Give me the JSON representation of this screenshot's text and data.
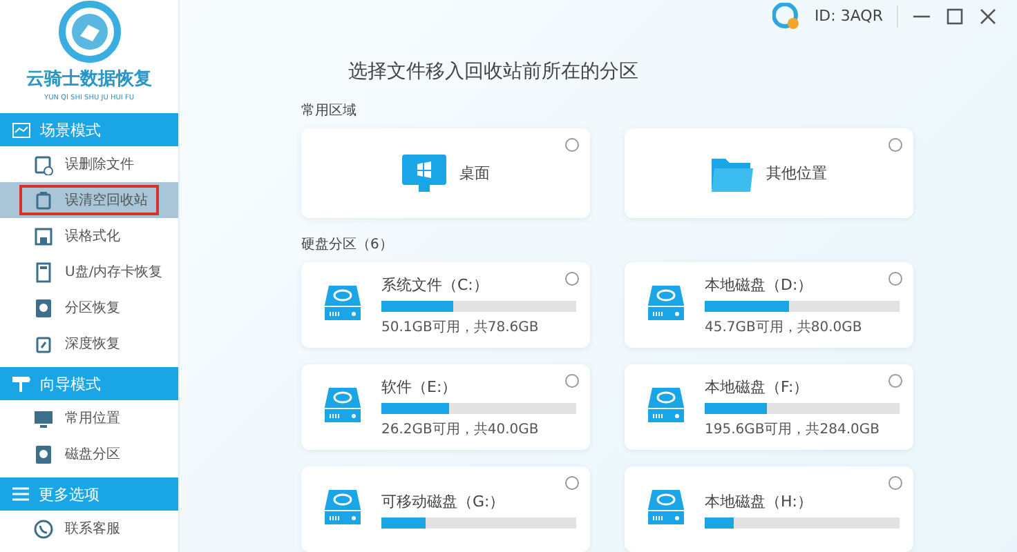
{
  "app": {
    "name": "云骑士数据恢复",
    "subtitle": "YUN QI SHI SHU JU HUI FU"
  },
  "account": {
    "id": "ID: 3AQR"
  },
  "sidebar": [
    {
      "title": "场景模式",
      "kind": "scene",
      "items": [
        {
          "label": "误删除文件",
          "kind": "file",
          "selected": false
        },
        {
          "label": "误清空回收站",
          "kind": "bin",
          "selected": true
        },
        {
          "label": "误格式化",
          "kind": "floppy",
          "selected": false
        },
        {
          "label": "U盘/内存卡恢复",
          "kind": "card",
          "selected": false
        },
        {
          "label": "分区恢复",
          "kind": "disk",
          "selected": false
        },
        {
          "label": "深度恢复",
          "kind": "deep",
          "selected": false
        }
      ]
    },
    {
      "title": "向导模式",
      "kind": "guide",
      "items": [
        {
          "label": "常用位置",
          "kind": "monitor",
          "selected": false
        },
        {
          "label": "磁盘分区",
          "kind": "disk",
          "selected": false
        }
      ]
    },
    {
      "title": "更多选项",
      "kind": "more",
      "items": [
        {
          "label": "联系客服",
          "kind": "phone",
          "selected": false
        }
      ]
    }
  ],
  "heading": "选择文件移入回收站前所在的分区",
  "common": {
    "title": "常用区域",
    "items": [
      {
        "label": "桌面",
        "kind": "desktop",
        "selected": false
      },
      {
        "label": "其他位置",
        "kind": "folder",
        "selected": false
      }
    ]
  },
  "disks": {
    "title": "硬盘分区（6）",
    "items": [
      {
        "name": "系统文件（C:）",
        "level": 0.37,
        "usage": "50.1GB可用，共78.6GB",
        "selected": false
      },
      {
        "name": "本地磁盘（D:）",
        "level": 0.43,
        "usage": "45.7GB可用，共80.0GB",
        "selected": false
      },
      {
        "name": "软件（E:）",
        "level": 0.35,
        "usage": "26.2GB可用，共40.0GB",
        "selected": false
      },
      {
        "name": "本地磁盘（F:）",
        "level": 0.32,
        "usage": "195.6GB可用，共284.0GB",
        "selected": false
      },
      {
        "name": "可移动磁盘（G:）",
        "level": 0.23,
        "selected": false
      },
      {
        "name": "本地磁盘（H:）",
        "level": 0.15,
        "selected": false
      }
    ]
  }
}
